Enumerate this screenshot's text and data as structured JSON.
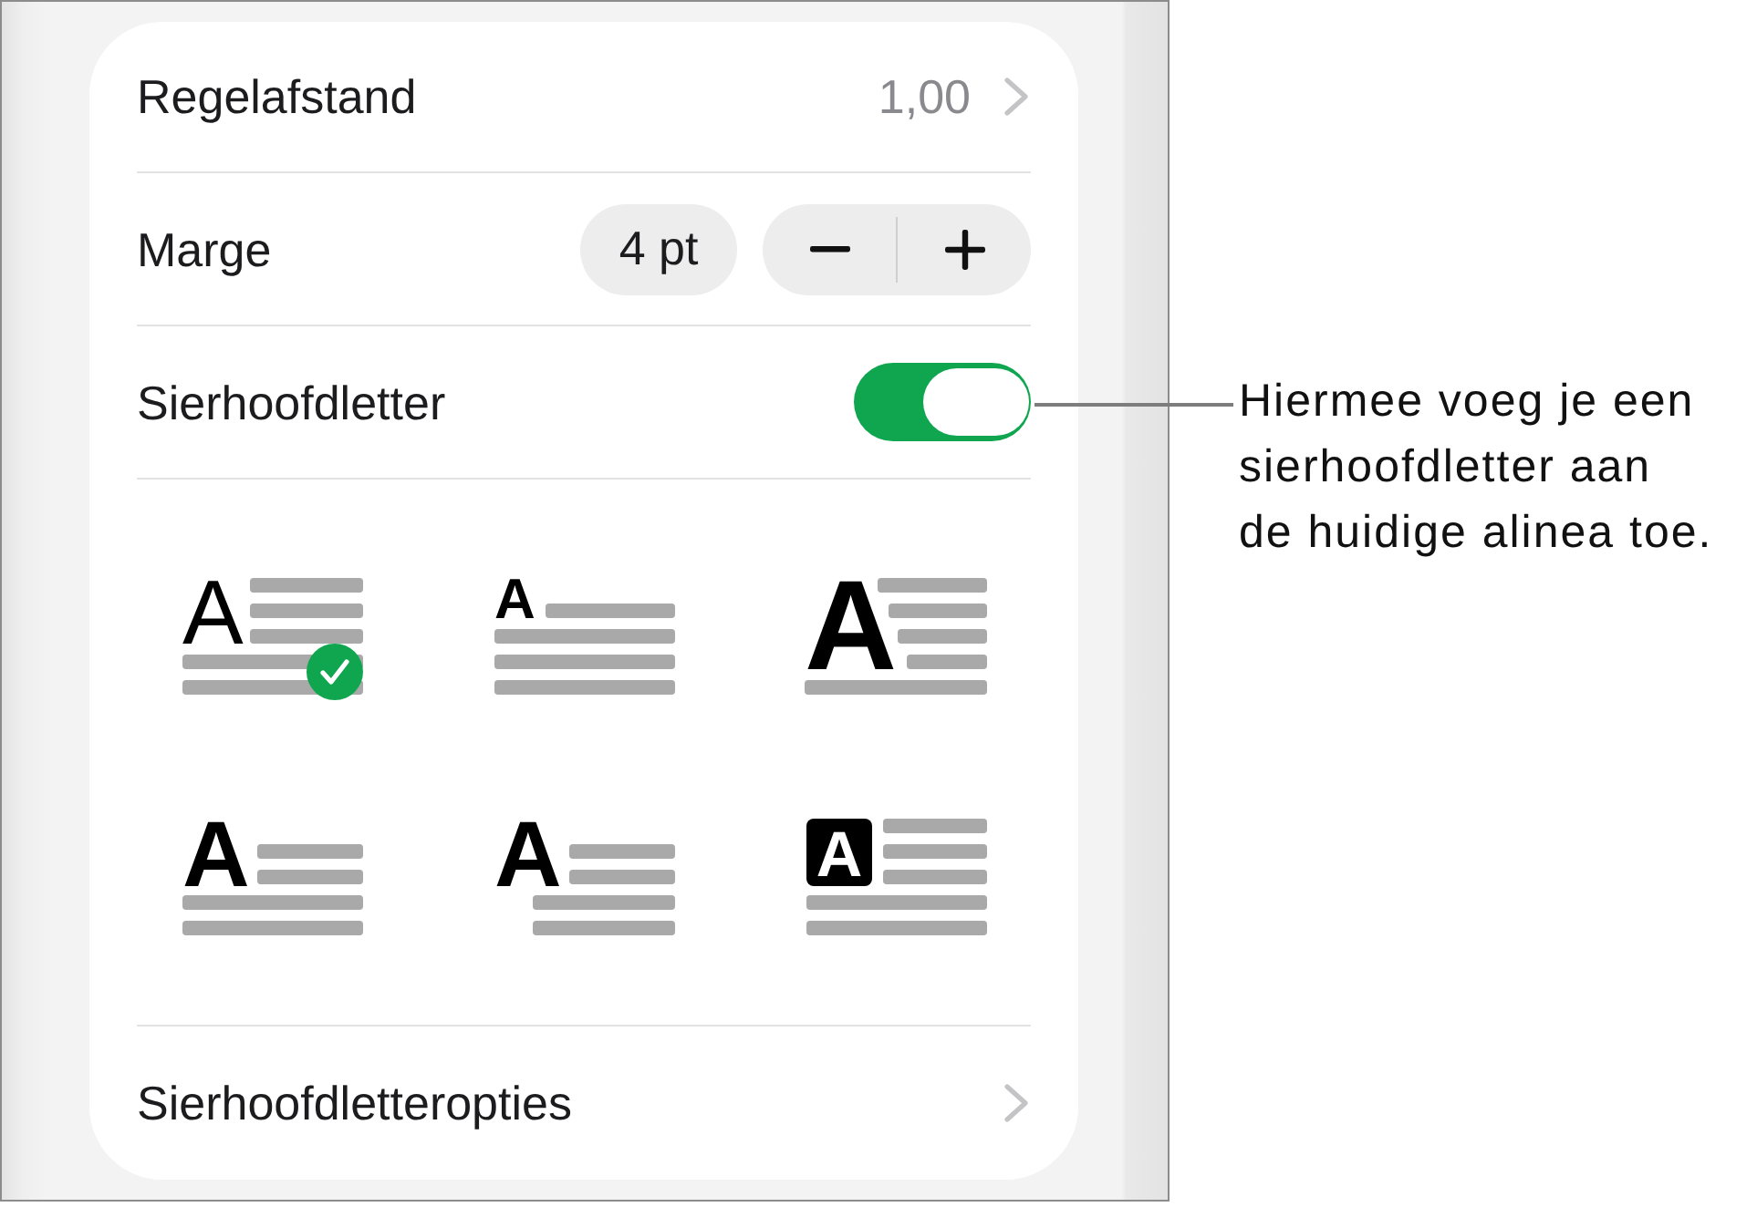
{
  "panel": {
    "line_spacing": {
      "label": "Regelafstand",
      "value": "1,00"
    },
    "margin": {
      "label": "Marge",
      "value": "4 pt"
    },
    "drop_cap": {
      "label": "Sierhoofdletter",
      "on": true
    },
    "drop_cap_styles": [
      {
        "kind": "light",
        "letter": "A",
        "selected": true
      },
      {
        "kind": "raised",
        "letter": "A",
        "selected": false
      },
      {
        "kind": "large",
        "letter": "A",
        "selected": false
      },
      {
        "kind": "inset",
        "letter": "A",
        "selected": false
      },
      {
        "kind": "hanging",
        "letter": "A",
        "selected": false
      },
      {
        "kind": "boxed",
        "letter": "A",
        "selected": false
      }
    ],
    "options_row": {
      "label": "Sierhoofdletteropties"
    }
  },
  "callout": {
    "lines": [
      "Hiermee voeg je een",
      "sierhoofdletter aan",
      "de huidige alinea toe."
    ]
  }
}
